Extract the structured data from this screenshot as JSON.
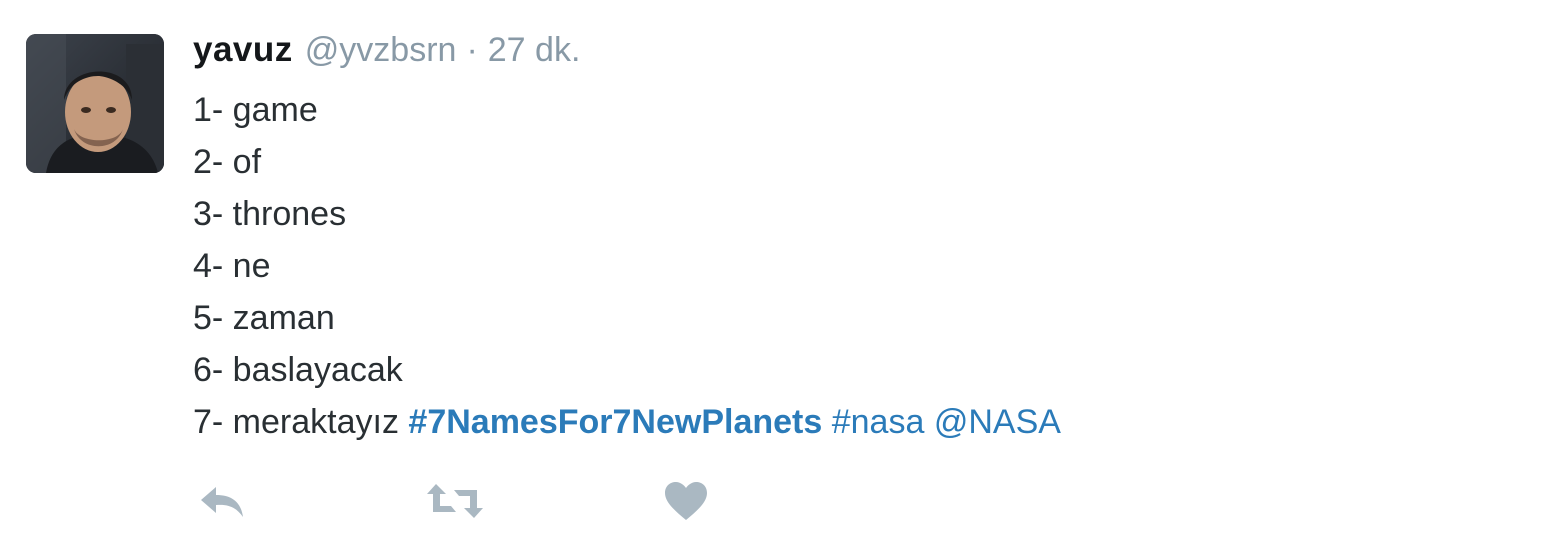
{
  "tweet": {
    "display_name": "yavuz",
    "handle": "@yvzbsrn",
    "separator": "·",
    "time": "27 dk.",
    "lines": [
      "1- game",
      "2- of",
      "3- thrones",
      "4- ne",
      "5- zaman",
      "6- baslayacak"
    ],
    "last_line": {
      "prefix": "7- meraktayız",
      "hashtag_main": "#7NamesFor7NewPlanets",
      "hashtag_nasa": "#nasa",
      "mention": "@NASA"
    }
  },
  "actions": {
    "reply_icon": "reply-icon",
    "retweet_icon": "retweet-icon",
    "like_icon": "heart-icon"
  },
  "colors": {
    "name": "#14171a",
    "meta": "#8899a6",
    "text": "#292f33",
    "link": "#2b7bb9",
    "icon": "#aab8c2"
  }
}
